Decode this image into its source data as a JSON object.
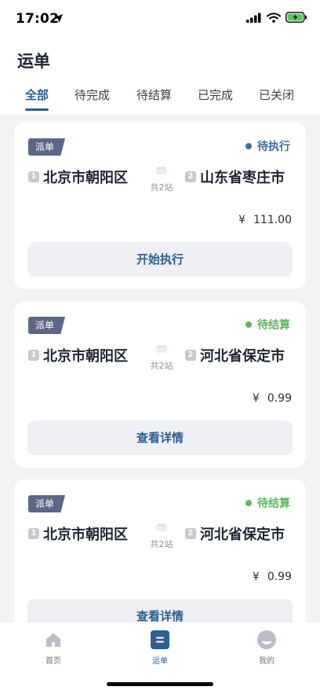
{
  "status_bar": {
    "time": "17:02"
  },
  "header": {
    "title": "运单",
    "tabs": [
      {
        "label": "全部",
        "active": true
      },
      {
        "label": "待完成",
        "active": false
      },
      {
        "label": "待结算",
        "active": false
      },
      {
        "label": "已完成",
        "active": false
      },
      {
        "label": "已关闭",
        "active": false
      }
    ]
  },
  "orders": [
    {
      "badge": "派单",
      "status": "待执行",
      "status_color": "#3a6ea5",
      "from_num": "1",
      "from": "北京市朝阳区",
      "via_dots": "···",
      "via": "共2站",
      "to_num": "2",
      "to": "山东省枣庄市",
      "currency": "¥",
      "amount": "111.00",
      "action": "开始执行"
    },
    {
      "badge": "派单",
      "status": "待结算",
      "status_color": "#5cb85c",
      "from_num": "1",
      "from": "北京市朝阳区",
      "via_dots": "···",
      "via": "共2站",
      "to_num": "2",
      "to": "河北省保定市",
      "currency": "¥",
      "amount": "0.99",
      "action": "查看详情"
    },
    {
      "badge": "派单",
      "status": "待结算",
      "status_color": "#5cb85c",
      "from_num": "1",
      "from": "北京市朝阳区",
      "via_dots": "···",
      "via": "共2站",
      "to_num": "2",
      "to": "河北省保定市",
      "currency": "¥",
      "amount": "0.99",
      "action": "查看详情"
    }
  ],
  "tabbar": {
    "items": [
      {
        "label": "首页",
        "icon": "home-icon",
        "active": false
      },
      {
        "label": "运单",
        "icon": "waybill-icon",
        "active": true
      },
      {
        "label": "我的",
        "icon": "profile-icon",
        "active": false
      }
    ]
  },
  "colors": {
    "accent": "#2e5f93",
    "badge": "#5c6687",
    "pending_exec": "#3a6ea5",
    "pending_settle": "#5cb85c"
  }
}
